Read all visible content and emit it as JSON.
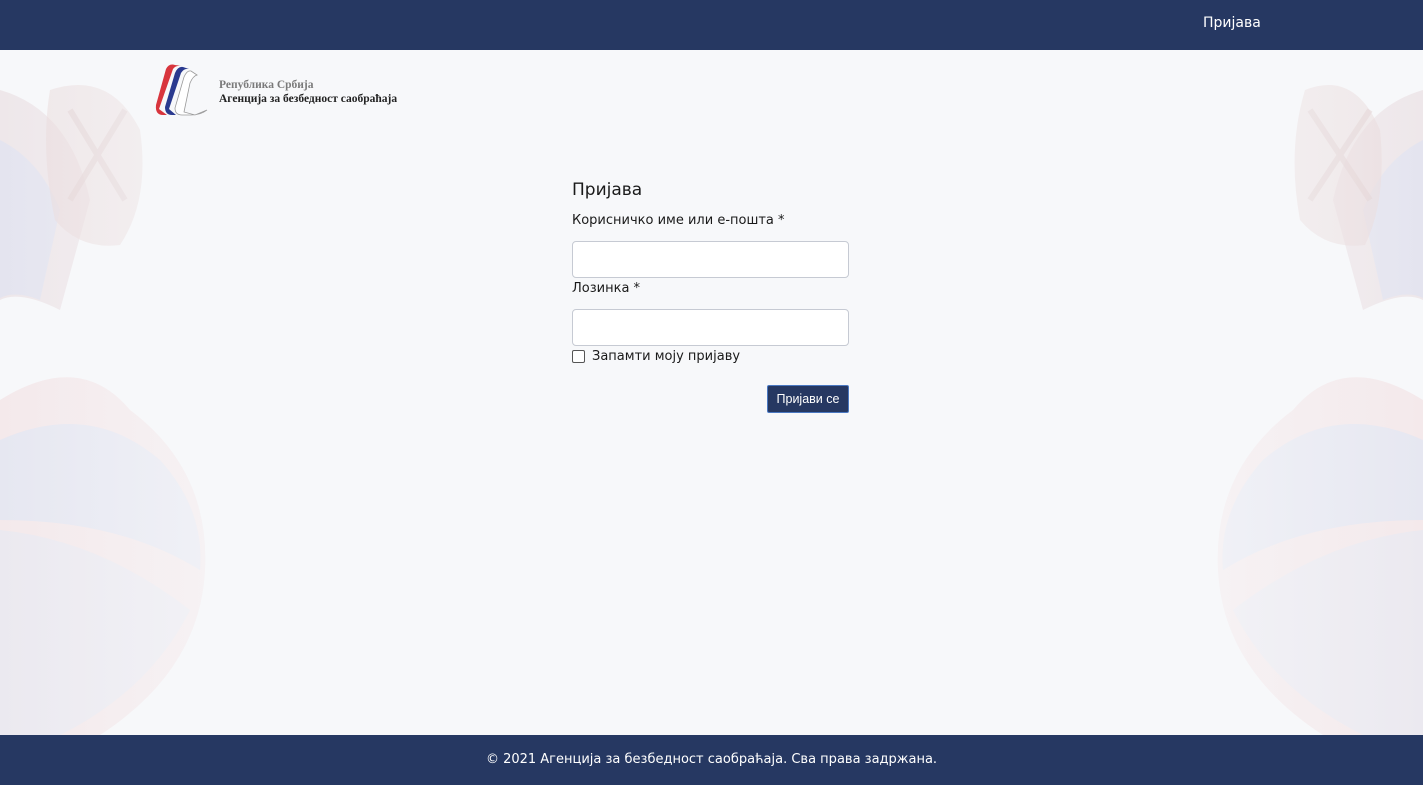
{
  "header": {
    "login_link": "Пријава"
  },
  "logo": {
    "line1": "Република Србија",
    "line2": "Агенција за безбедност саобраћаја"
  },
  "form": {
    "title": "Пријава",
    "username_label": "Корисничко име или е-пошта *",
    "username_value": "",
    "password_label": "Лозинка *",
    "password_value": "",
    "remember_label": "Запамти моју пријаву",
    "remember_checked": false,
    "submit_label": "Пријави се"
  },
  "footer": {
    "copyright": "© 2021 Агенција за безбедност саобраћаја. Сва права задржана."
  },
  "colors": {
    "brand_navy": "#263862",
    "background": "#f7f8fa",
    "flag_red": "#d8353d",
    "flag_blue": "#2a3a8f"
  },
  "icons": {
    "logo_mark": "agency-stripes-logo-icon",
    "checkbox": "checkbox-unchecked-icon"
  }
}
